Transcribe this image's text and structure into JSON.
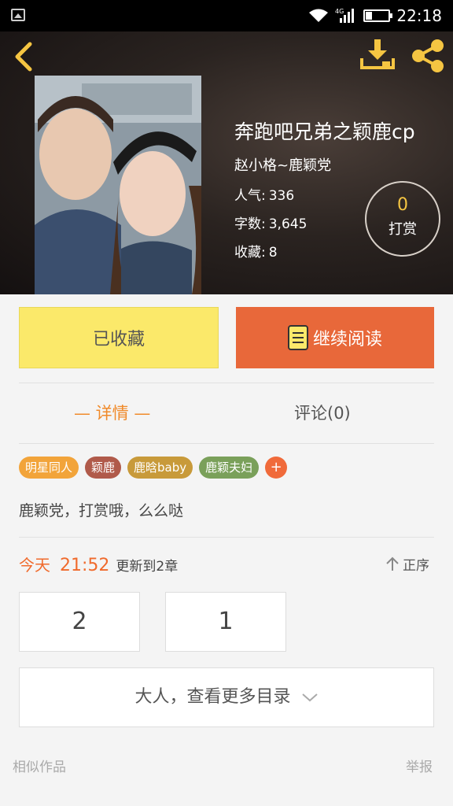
{
  "status_bar": {
    "network": "4G",
    "time": "22:18"
  },
  "book": {
    "title": "奔跑吧兄弟之颖鹿cp",
    "author": "赵小格~鹿颖党",
    "stats": [
      {
        "label": "人气:",
        "value": "336"
      },
      {
        "label": "字数:",
        "value": "3,645"
      },
      {
        "label": "收藏:",
        "value": "8"
      }
    ],
    "tip_count": "0",
    "tip_label": "打赏"
  },
  "actions": {
    "favorite_label": "已收藏",
    "continue_label": "继续阅读"
  },
  "tabs": {
    "detail": "— 详情 —",
    "comment": "评论(0)"
  },
  "tags": [
    {
      "label": "明星同人",
      "color": "#f2a43a"
    },
    {
      "label": "颖鹿",
      "color": "#b05a4a"
    },
    {
      "label": "鹿晗baby",
      "color": "#c89a3a"
    },
    {
      "label": "鹿颖夫妇",
      "color": "#7aa05a"
    },
    {
      "label": "+",
      "color": "#f06a3a"
    }
  ],
  "description": "鹿颖党，打赏哦，么么哒",
  "update": {
    "day": "今天",
    "time": "21:52",
    "message": "更新到2章",
    "sort_label": "正序"
  },
  "chapters": [
    "2",
    "1"
  ],
  "more_catalog": "大人，查看更多目录",
  "footer": {
    "similar": "相似作品",
    "report": "举报"
  },
  "colors": {
    "accent_orange": "#e8683a",
    "yellow": "#fbe96a",
    "icon_yellow": "#f5c542"
  }
}
